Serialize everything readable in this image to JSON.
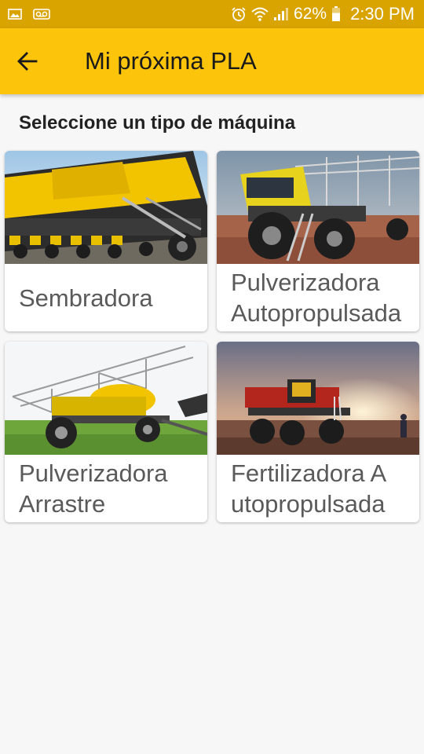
{
  "status_bar": {
    "battery": "62%",
    "time": "2:30 PM",
    "icons": [
      "gallery-icon",
      "voicemail-icon",
      "alarm-icon",
      "wifi-icon",
      "signal-icon",
      "battery-icon"
    ]
  },
  "app_bar": {
    "title": "Mi próxima PLA",
    "back_icon": "arrow-left-icon"
  },
  "section_title": "Seleccione un tipo de máquina",
  "machines": [
    {
      "label": "Sembradora"
    },
    {
      "label": "Pulverizadora Autopropulsada"
    },
    {
      "label": "Pulverizadora Arrastre"
    },
    {
      "label": "Fertilizadora A utopropulsada"
    }
  ],
  "colors": {
    "status_bar": "#d9a400",
    "app_bar": "#fcc40a",
    "background": "#f7f7f7",
    "label_text": "#5a5a5a"
  }
}
